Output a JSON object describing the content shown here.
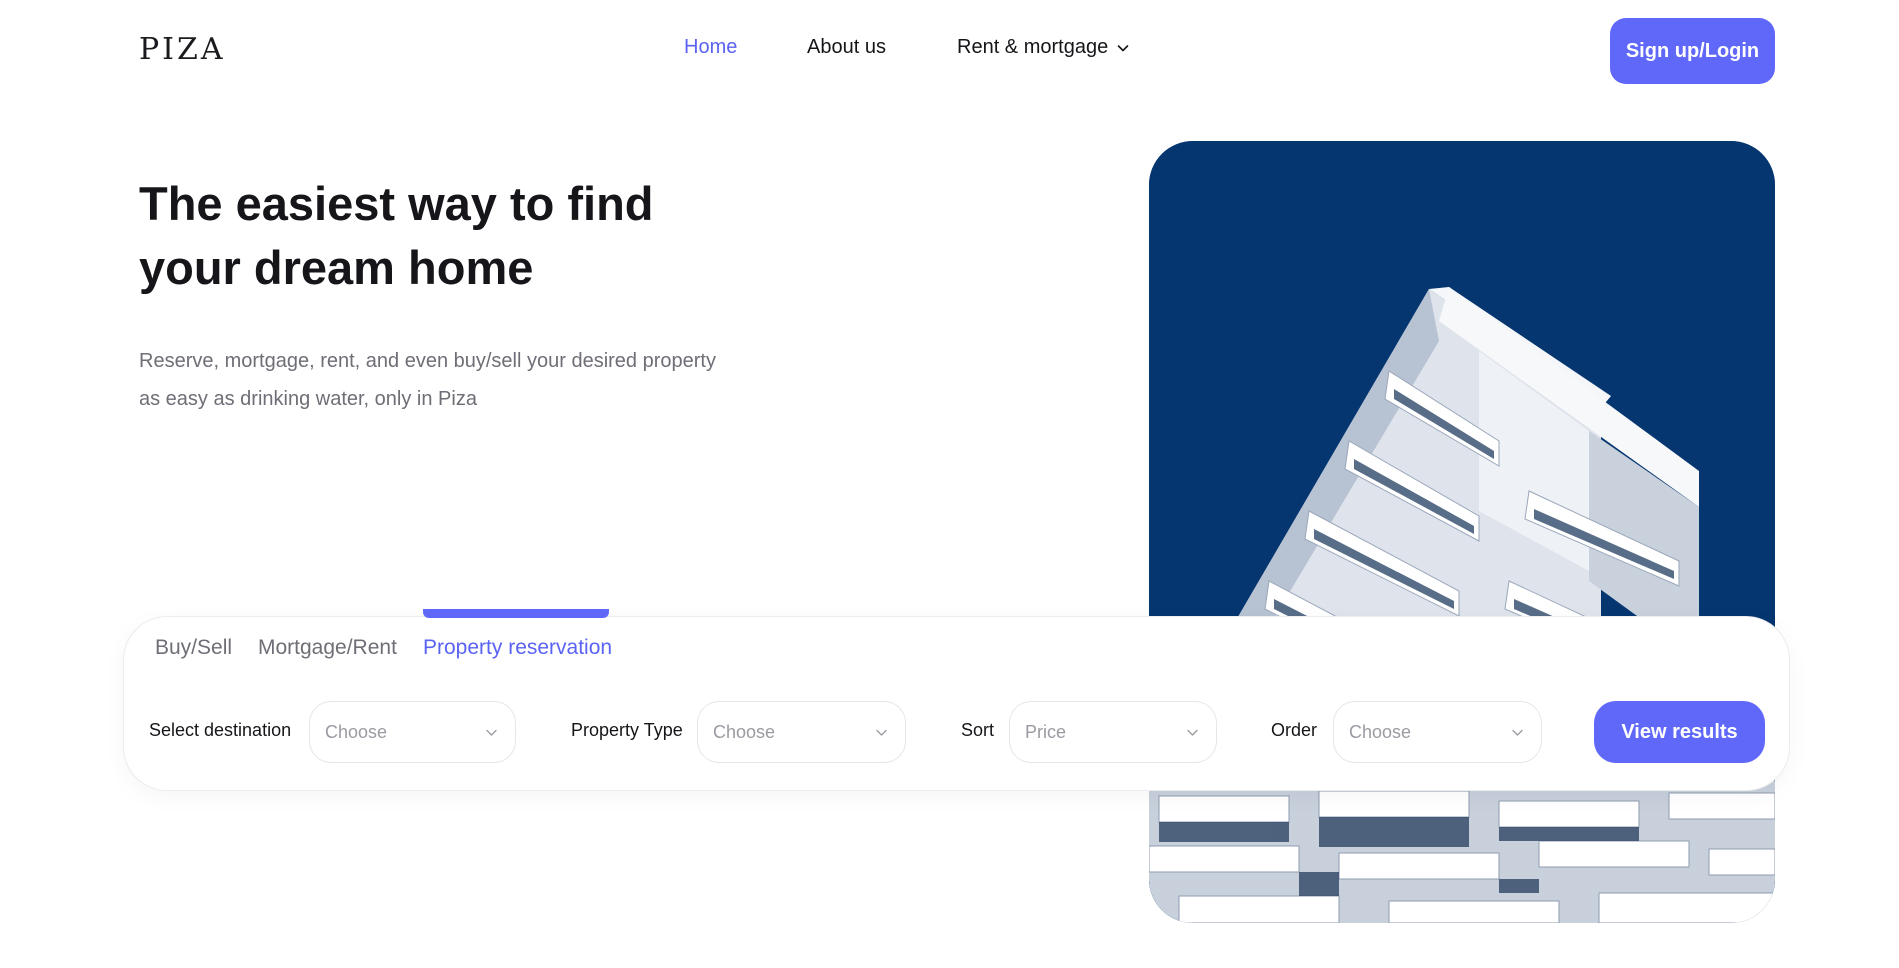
{
  "brand": {
    "logo": "PIZA"
  },
  "nav": {
    "items": [
      {
        "label": "Home",
        "active": true
      },
      {
        "label": "About us",
        "active": false
      },
      {
        "label": "Rent & mortgage",
        "active": false,
        "has_dropdown": true
      }
    ]
  },
  "header": {
    "signup_label": "Sign up/Login"
  },
  "hero": {
    "title_line1": "The easiest way to find",
    "title_line2": "your dream home",
    "subtitle_line1": "Reserve, mortgage, rent, and even buy/sell your desired property",
    "subtitle_line2": "as easy as drinking water, only in Piza"
  },
  "search": {
    "tabs": [
      {
        "label": "Buy/Sell",
        "active": false
      },
      {
        "label": "Mortgage/Rent",
        "active": false
      },
      {
        "label": "Property reservation",
        "active": true
      }
    ],
    "fields": [
      {
        "label": "Select destination",
        "value": "Choose"
      },
      {
        "label": "Property Type",
        "value": "Choose"
      },
      {
        "label": "Sort",
        "value": "Price"
      },
      {
        "label": "Order",
        "value": "Choose"
      }
    ],
    "submit_label": "View results"
  },
  "colors": {
    "accent": "#6068f9",
    "accent_text": "#5a63f2",
    "hero_image_sky": "#053670",
    "muted_text": "#6e6e77"
  },
  "icons": {
    "nav_dropdown": "chevron-down-icon",
    "select_dropdown": "chevron-down-icon"
  }
}
